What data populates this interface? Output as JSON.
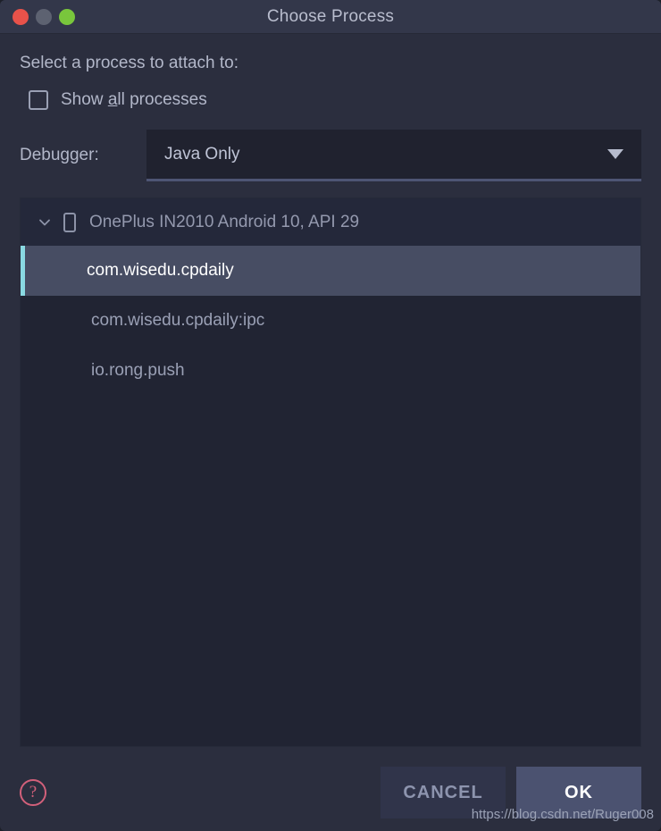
{
  "window": {
    "title": "Choose Process",
    "traffic_lights": [
      {
        "name": "close",
        "color": "#e8524a"
      },
      {
        "name": "minimize",
        "color": "#5d6271"
      },
      {
        "name": "maximize",
        "color": "#79c63c"
      }
    ]
  },
  "form": {
    "prompt": "Select a process to attach to:",
    "show_all": {
      "label_before": "Show ",
      "mnemonic": "a",
      "label_after": "ll processes",
      "checked": false
    },
    "debugger": {
      "label": "Debugger:",
      "value": "Java Only",
      "arrow_icon": "chevron-down-icon"
    }
  },
  "process_list": {
    "device": {
      "expanded": true,
      "expand_icon": "chevron-down-icon",
      "device_icon": "phone-icon",
      "label": "OnePlus IN2010 Android 10, API 29"
    },
    "processes": [
      {
        "name": "com.wisedu.cpdaily",
        "selected": true
      },
      {
        "name": "com.wisedu.cpdaily:ipc",
        "selected": false
      },
      {
        "name": "io.rong.push",
        "selected": false
      }
    ],
    "selection_accent": "#8ad9e2",
    "selection_bg": "#474d63"
  },
  "footer": {
    "help_icon": "question-mark-icon",
    "help_label": "?",
    "cancel_label": "CANCEL",
    "ok_label": "OK"
  },
  "watermark": "https://blog.csdn.net/Ruger008"
}
